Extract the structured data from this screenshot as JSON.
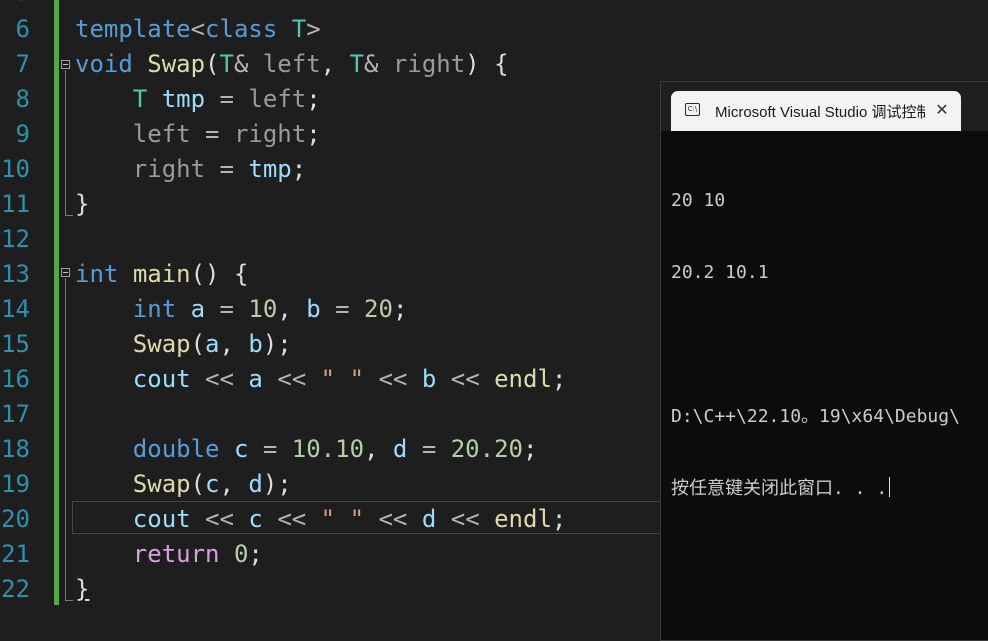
{
  "editor": {
    "line_numbers": [
      "6",
      "7",
      "8",
      "9",
      "10",
      "11",
      "12",
      "13",
      "14",
      "15",
      "16",
      "17",
      "18",
      "19",
      "20",
      "21",
      "22"
    ]
  },
  "console": {
    "title": "Microsoft Visual Studio 调试控制台",
    "icon_label": "C:\\",
    "close_glyph": "✕",
    "lines": [
      "20 10",
      "20.2 10.1",
      "",
      "D:\\C++\\22.10。19\\x64\\Debug\\",
      "按任意键关闭此窗口. . ."
    ]
  }
}
